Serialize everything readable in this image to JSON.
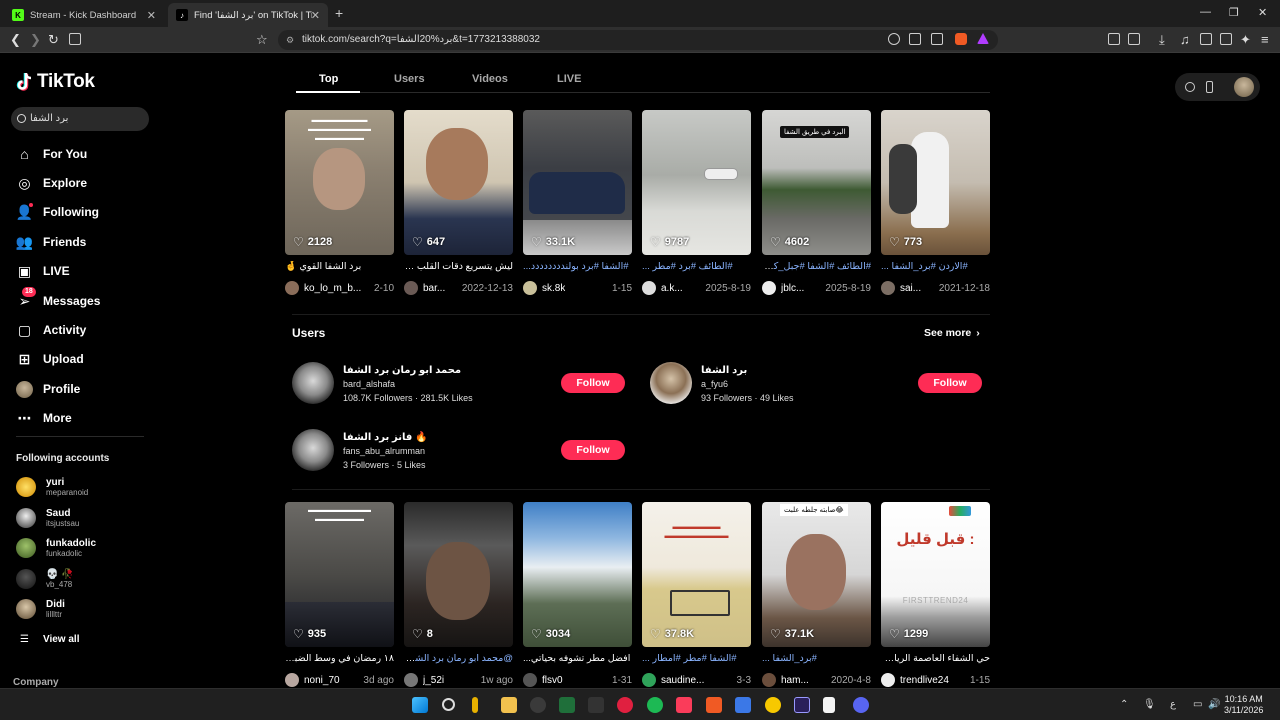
{
  "browser": {
    "tabs": [
      {
        "title": "Stream - Kick Dashboard",
        "active": false
      },
      {
        "title": "Find 'برد الشفا' on TikTok | TikTok",
        "active": true
      }
    ],
    "url": "tiktok.com/search?q=برد%20الشفا&t=1773213388032"
  },
  "sidebar": {
    "logo": "TikTok",
    "search_value": "برد الشفا",
    "nav": [
      {
        "label": "For You",
        "icon": "home-icon"
      },
      {
        "label": "Explore",
        "icon": "compass-icon"
      },
      {
        "label": "Following",
        "icon": "following-icon"
      },
      {
        "label": "Friends",
        "icon": "friends-icon"
      },
      {
        "label": "LIVE",
        "icon": "live-icon"
      },
      {
        "label": "Messages",
        "icon": "messages-icon",
        "badge": "18"
      },
      {
        "label": "Activity",
        "icon": "activity-icon"
      },
      {
        "label": "Upload",
        "icon": "upload-icon"
      },
      {
        "label": "Profile",
        "icon": "profile-avatar"
      },
      {
        "label": "More",
        "icon": "more-icon"
      }
    ],
    "following_title": "Following accounts",
    "following": [
      {
        "name": "yuri",
        "username": "meparanoid"
      },
      {
        "name": "Saud",
        "username": "itsjustsau"
      },
      {
        "name": "funkadolic",
        "username": "funkadolic"
      },
      {
        "name": "💀 🥀",
        "username": "vb_478"
      },
      {
        "name": "Didi",
        "username": "lilllttr"
      }
    ],
    "view_all": "View all",
    "company": "Company"
  },
  "tabs": [
    "Top",
    "Users",
    "Videos",
    "LIVE"
  ],
  "videos_top": [
    {
      "likes": "2128",
      "caption": "برد الشفا القوي 🤞",
      "user": "ko_lo_m_b...",
      "date": "2-10"
    },
    {
      "likes": "647",
      "caption": "ليش يتسريع دقات القلب ملبون...",
      "user": "bar...",
      "date": "2022-12-13"
    },
    {
      "likes": "33.1K",
      "caption": "#الشفا #برد بولندددددددد...",
      "user": "sk.8k",
      "date": "1-15"
    },
    {
      "likes": "9787",
      "caption": "#الطائف #برد #مطر ...",
      "user": "a.k...",
      "date": "2025-8-19"
    },
    {
      "likes": "4602",
      "caption": "#الطائف #الشفا #جبل_كافيه",
      "user": "jblc...",
      "date": "2025-8-19"
    },
    {
      "likes": "773",
      "caption": "#الاردن #برد_الشفا ...",
      "user": "sai...",
      "date": "2021-12-18"
    }
  ],
  "users_section": {
    "title": "Users",
    "see_more": "See more",
    "users": [
      {
        "name": "محمد ابو رمان برد الشفا",
        "handle": "bard_alshafa",
        "followers": "108.7K Followers",
        "likes": "281.5K Likes",
        "follow": "Follow"
      },
      {
        "name": "برد الشفا",
        "handle": "a_fyu6",
        "followers": "93 Followers",
        "likes": "49 Likes",
        "follow": "Follow"
      },
      {
        "name": "فانز برد الشفا 🔥",
        "handle": "fans_abu_alrumman",
        "followers": "3 Followers",
        "likes": "5 Likes",
        "follow": "Follow"
      }
    ]
  },
  "videos_bottom": [
    {
      "likes": "935",
      "caption": "١٨ رمضان في وسط الضباب ...",
      "user": "noni_70",
      "date": "3d ago"
    },
    {
      "likes": "8",
      "caption": "@محمد ابو رمان برد الشفا...",
      "user": "j_52i",
      "date": "1w ago"
    },
    {
      "likes": "3034",
      "caption": "افضل مطر تشوفه بحياتي...",
      "user": "flsv0",
      "date": "1-31"
    },
    {
      "likes": "37.8K",
      "caption": "#الشفا #مطر #امطار ...",
      "user": "saudine...",
      "date": "3-3"
    },
    {
      "likes": "37.1K",
      "caption": "#برد_الشفا ...",
      "user": "ham...",
      "date": "2020-4-8"
    },
    {
      "likes": "1299",
      "caption": "حي الشفاء العاصمة الرياض ...",
      "user": "trendlive24",
      "date": "1-15"
    }
  ],
  "overlays": {
    "v5": "البرد في طريق الشفا",
    "b5": "صابته جلطه علبت😂",
    "b6_title": "قبل قليل :",
    "b6_brand": "FIRSTTREND24"
  },
  "taskbar": {
    "time": "10:16 AM",
    "date": "3/11/2026",
    "lang": "ع"
  },
  "colors": {
    "accent": "#fe2c55",
    "tag": "#8ab4ff"
  }
}
